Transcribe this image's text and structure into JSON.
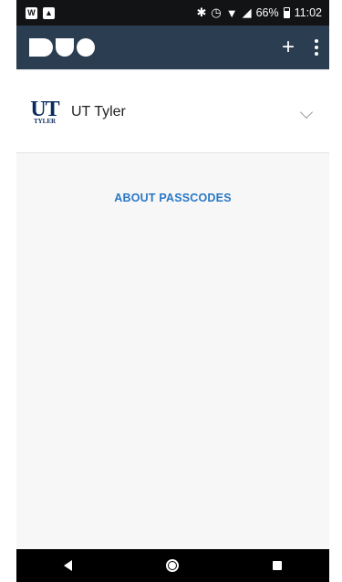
{
  "status_bar": {
    "notif_w": "W",
    "battery_text": "66%",
    "time": "11:02",
    "icons": [
      "bluetooth-icon",
      "alarm-icon",
      "wifi-icon",
      "signal-icon",
      "battery-icon"
    ]
  },
  "app_bar": {
    "logo": "duo-logo",
    "add_icon": "plus-icon",
    "menu_icon": "kebab-menu-icon",
    "color": "#2b3d50"
  },
  "account": {
    "logo_top": "UT",
    "logo_bottom": "TYLER",
    "name": "UT Tyler"
  },
  "about_link": "ABOUT PASSCODES",
  "nav_bar": [
    "back-icon",
    "home-icon",
    "recent-apps-icon"
  ],
  "colors": {
    "link": "#2a78c6",
    "app_bar": "#2b3d50"
  }
}
